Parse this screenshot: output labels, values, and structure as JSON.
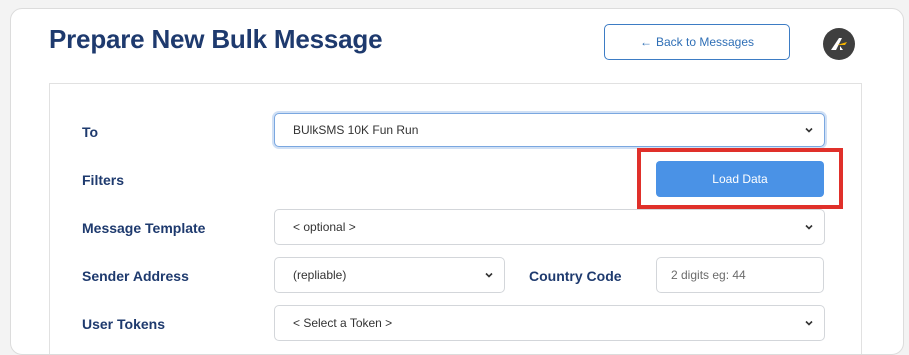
{
  "header": {
    "title": "Prepare New Bulk Message",
    "back_label": "Back to Messages"
  },
  "form": {
    "to": {
      "label": "To",
      "value": "BUlkSMS 10K Fun Run"
    },
    "filters": {
      "label": "Filters",
      "load_label": "Load Data"
    },
    "template": {
      "label": "Message Template",
      "value": "< optional >"
    },
    "sender": {
      "label": "Sender Address",
      "value": "(repliable)"
    },
    "country": {
      "label": "Country Code",
      "placeholder": "2 digits eg: 44"
    },
    "tokens": {
      "label": "User Tokens",
      "value": "< Select a Token >"
    }
  },
  "colors": {
    "title": "#1e3a6e",
    "primary_button": "#4a92e6",
    "highlight": "#e0302a",
    "outline_button": "#3d7cc4"
  },
  "icons": [
    "arrow-left-icon",
    "chevron-down-icon",
    "app-logo-icon"
  ]
}
